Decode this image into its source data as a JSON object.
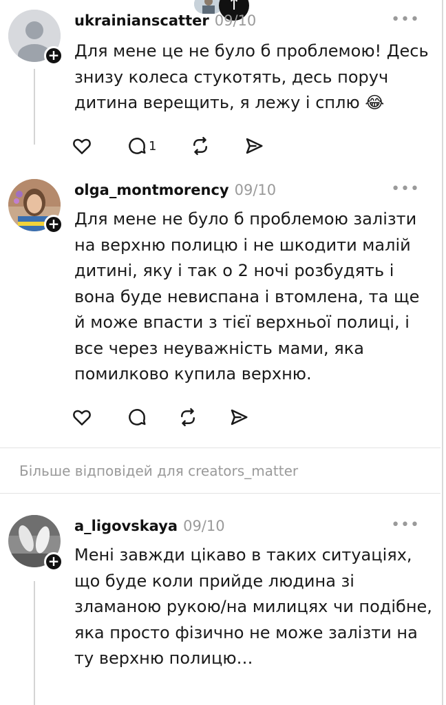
{
  "posts": [
    {
      "username": "ukrainianscatter",
      "date": "09/10",
      "text": "Для мене це не було б проблемою! Десь знизу колеса стукотять, десь поруч дитина верещить, я лежу і сплю 😂",
      "actions": {
        "reply_count": "1"
      }
    },
    {
      "username": "olga_montmorency",
      "date": "09/10",
      "text": "Для мене не було б проблемою залізти на верхню полицю і не шкодити малій дитині, яку і так о 2 ночі розбудять і вона буде невиспана і втомлена, та ще й може впасти з тієї верхньої полиці, і все через неуважність мами, яка помилково купила верхню.",
      "actions": {
        "reply_count": ""
      }
    },
    {
      "username": "a_ligovskaya",
      "date": "09/10",
      "text": "Мені завжди цікаво в таких ситуаціях, що буде коли прийде людина зі зламаною рукою/на милицях чи подібне, яка просто фізично не може залізти на ту верхню полицю…"
    }
  ],
  "more_replies_label": "Більше відповідей для creators_matter",
  "more_label": "•••",
  "icons": [
    "heart-icon",
    "comment-icon",
    "repost-icon",
    "share-icon",
    "plus-icon",
    "arrow-up-icon"
  ]
}
